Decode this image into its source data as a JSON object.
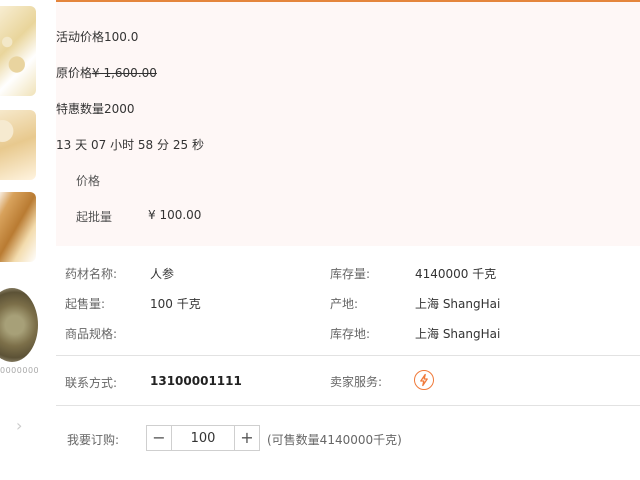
{
  "thumbnails": {
    "caption": "0000000",
    "next_arrow": "›"
  },
  "promo": {
    "activity_label": "活动价格",
    "activity_price": "100.0",
    "original_label": "原价格",
    "original_price": "¥ 1,600.00",
    "special_label": "特惠数量",
    "special_qty": "2000",
    "countdown": {
      "days": "13",
      "days_unit": "天",
      "hours": "07",
      "hours_unit": "小时",
      "minutes": "58",
      "minutes_unit": "分",
      "seconds": "25",
      "seconds_unit": "秒"
    },
    "price_header": "价格",
    "min_batch_label": "起批量",
    "min_batch_price": "¥ 100.00"
  },
  "info": {
    "name_label": "药材名称:",
    "name_value": "人参",
    "stock_label": "库存量:",
    "stock_value": "4140000 千克",
    "min_sale_label": "起售量:",
    "min_sale_value": "100 千克",
    "origin_label": "产地:",
    "origin_value": "上海 ShangHai",
    "spec_label": "商品规格:",
    "spec_value": "",
    "stock_loc_label": "库存地:",
    "stock_loc_value": "上海 ShangHai"
  },
  "contact": {
    "label": "联系方式:",
    "value": "13100001111"
  },
  "service": {
    "label": "卖家服务:",
    "icon": "lightning-icon",
    "icon_color": "#f07a3a"
  },
  "order": {
    "label": "我要订购:",
    "minus": "−",
    "quantity": "100",
    "plus": "+",
    "available": "(可售数量4140000千克)"
  },
  "colors": {
    "accent": "#e4853b",
    "promo_bg": "#fef7f6"
  }
}
